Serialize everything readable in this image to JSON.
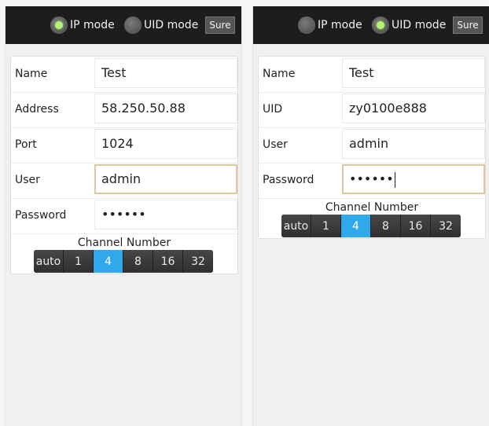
{
  "screens": [
    {
      "modes": {
        "ip_label": "IP mode",
        "uid_label": "UID mode",
        "selected": "IP mode",
        "sure_label": "Sure"
      },
      "fields": {
        "name_label": "Name",
        "name_value": "Test",
        "address_label": "Address",
        "address_value": "58.250.50.88",
        "port_label": "Port",
        "port_value": "1024",
        "user_label": "User",
        "user_value": "admin",
        "password_label": "Password",
        "password_value": "••••••"
      },
      "channel": {
        "title": "Channel Number",
        "options": [
          "auto",
          "1",
          "4",
          "8",
          "16",
          "32"
        ],
        "selected": "4"
      }
    },
    {
      "modes": {
        "ip_label": "IP mode",
        "uid_label": "UID mode",
        "selected": "UID mode",
        "sure_label": "Sure"
      },
      "fields": {
        "name_label": "Name",
        "name_value": "Test",
        "uid_label": "UID",
        "uid_value": "zy0100e888",
        "user_label": "User",
        "user_value": "admin",
        "password_label": "Password",
        "password_value": "••••••"
      },
      "channel": {
        "title": "Channel Number",
        "options": [
          "auto",
          "1",
          "4",
          "8",
          "16",
          "32"
        ],
        "selected": "4"
      }
    }
  ],
  "colors": {
    "topbar": "#1d1d1d",
    "radio_on": "#b4f27a",
    "segment_active": "#2fa9ec",
    "focus_border": "#e2c79a"
  }
}
